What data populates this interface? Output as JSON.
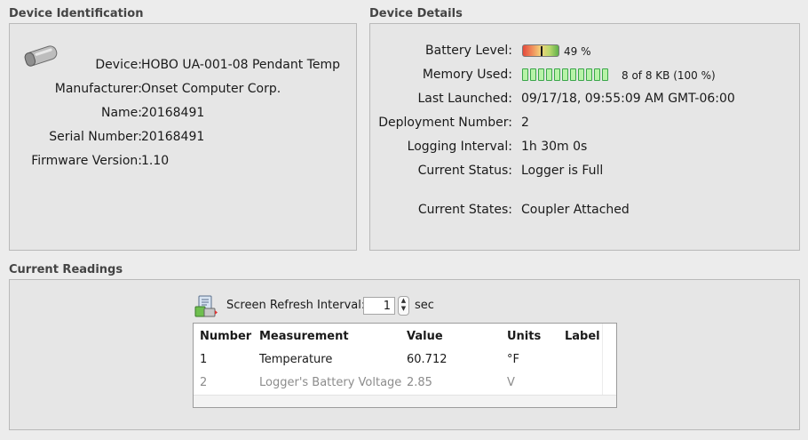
{
  "device_identification": {
    "title": "Device Identification",
    "icon": "pendant-logger-icon",
    "rows": [
      {
        "label": "Device:",
        "value": "HOBO UA-001-08 Pendant Temp"
      },
      {
        "label": "Manufacturer:",
        "value": "Onset Computer Corp."
      },
      {
        "label": "Name:",
        "value": "20168491"
      },
      {
        "label": "Serial Number:",
        "value": "20168491"
      },
      {
        "label": "Firmware Version:",
        "value": "1.10"
      }
    ]
  },
  "device_details": {
    "title": "Device Details",
    "battery": {
      "label": "Battery Level:",
      "value": "49 %",
      "level": 0.49
    },
    "memory": {
      "label": "Memory Used:",
      "value": "8 of 8 KB (100 %)",
      "fraction": 1.0,
      "cells": 11
    },
    "rows": [
      {
        "label": "Last Launched:",
        "value": "09/17/18, 09:55:09 AM GMT-06:00"
      },
      {
        "label": "Deployment Number:",
        "value": "2"
      },
      {
        "label": "Logging Interval:",
        "value": "1h 30m 0s"
      },
      {
        "label": "Current Status:",
        "value": "Logger is Full"
      },
      {
        "label": "Current States:",
        "value": "Coupler Attached"
      }
    ]
  },
  "current_readings": {
    "title": "Current Readings",
    "icon": "readings-icon",
    "refresh_label": "Screen Refresh Interval:",
    "refresh_value": "1",
    "refresh_unit": "sec",
    "columns": [
      "Number",
      "Measurement",
      "Value",
      "Units",
      "Label"
    ],
    "rows": [
      {
        "number": "1",
        "measurement": "Temperature",
        "value": "60.712",
        "units": "°F",
        "label": ""
      },
      {
        "number": "2",
        "measurement": "Logger's Battery Voltage",
        "value": "2.85",
        "units": "V",
        "label": ""
      }
    ]
  },
  "colors": {
    "panel": "#e6e6e6",
    "memory_cell": "#b8f3a8",
    "dim_text": "#8c8c8c"
  }
}
